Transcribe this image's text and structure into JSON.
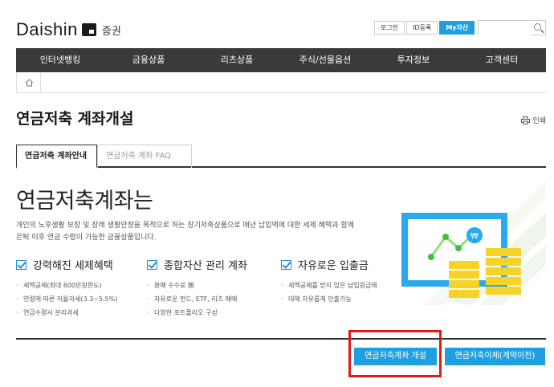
{
  "header": {
    "logo_text": "Daishin",
    "logo_sub": "증권",
    "util_links": [
      "로그인",
      "ID등록",
      "My자산"
    ],
    "search_placeholder": ""
  },
  "gnb": [
    "인터넷뱅킹",
    "금융상품",
    "리츠상품",
    "주식/선물옵션",
    "투자정보",
    "고객센터"
  ],
  "page": {
    "title": "연금저축 계좌개설",
    "print_label": "인쇄"
  },
  "tabs": {
    "active": "연금저축 계좌안내",
    "inactive": "연금저축 계좌 FAQ"
  },
  "hero": {
    "title": "연금저축계좌는",
    "desc_line1": "개인의 노후생활 보장 및 장래 생활안정을 목적으로 하는 장기저축상품으로 매년 납입액에 대한 세제 혜택과 함께",
    "desc_line2": "은퇴 이후 연금 수령이 가능한 금융상품입니다."
  },
  "features": [
    {
      "title": "강력해진 세제혜택",
      "items": [
        "세액공제(최대 600만원한도)",
        "연령에 따른 저율과세(3.3~5.5%)",
        "연금수령시 분리과세"
      ]
    },
    {
      "title": "종합자산 관리 계좌",
      "items": [
        "환매 수수료 無",
        "자유로운 펀드, ETF, 리츠 매매",
        "다양한 포트폴리오 구성"
      ]
    },
    {
      "title": "자유로운 입출금",
      "items": [
        "세액공제를 받지 않은 납입원금에",
        "대해 자유롭게 인출가능"
      ]
    }
  ],
  "buttons": {
    "open": "연금저축계좌 개설",
    "transfer": "연금저축이체(계약이전)"
  },
  "colors": {
    "accent": "#1e9fe0",
    "gnb_bg": "#3a3a3a",
    "highlight": "#e01919",
    "coin": "#f5d328"
  }
}
